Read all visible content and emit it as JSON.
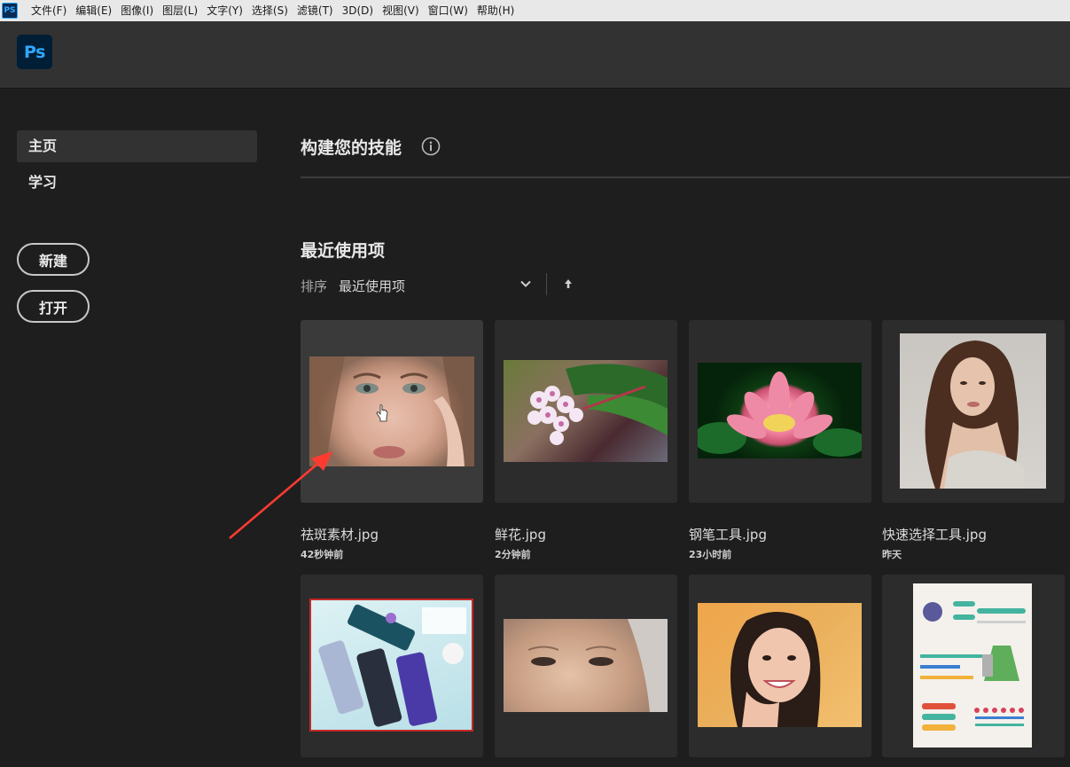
{
  "menubar": {
    "app_icon": "PS",
    "items": [
      "文件(F)",
      "编辑(E)",
      "图像(I)",
      "图层(L)",
      "文字(Y)",
      "选择(S)",
      "滤镜(T)",
      "3D(D)",
      "视图(V)",
      "窗口(W)",
      "帮助(H)"
    ]
  },
  "header": {
    "logo": "Ps"
  },
  "sidebar": {
    "nav": [
      {
        "label": "主页",
        "active": true
      },
      {
        "label": "学习",
        "active": false
      }
    ],
    "new_button": "新建",
    "open_button": "打开"
  },
  "main": {
    "skills_title": "构建您的技能",
    "recent_title": "最近使用项",
    "sort": {
      "label": "排序",
      "value": "最近使用项"
    },
    "files": [
      {
        "name": "祛斑素材.jpg",
        "time": "42秒钟前",
        "thumb": "face-close-up"
      },
      {
        "name": "鲜花.jpg",
        "time": "2分钟前",
        "thumb": "flower"
      },
      {
        "name": "钢笔工具.jpg",
        "time": "23小时前",
        "thumb": "lotus"
      },
      {
        "name": "快速选择工具.jpg",
        "time": "昨天",
        "thumb": "woman-portrait"
      },
      {
        "name": "",
        "time": "",
        "thumb": "phones"
      },
      {
        "name": "",
        "time": "",
        "thumb": "older-face"
      },
      {
        "name": "",
        "time": "",
        "thumb": "smiling-girl"
      },
      {
        "name": "",
        "time": "",
        "thumb": "infographic"
      }
    ]
  },
  "colors": {
    "background": "#1e1e1e",
    "header": "#323232",
    "accent": "#31a8ff",
    "annotation_arrow": "#ff3b30"
  }
}
